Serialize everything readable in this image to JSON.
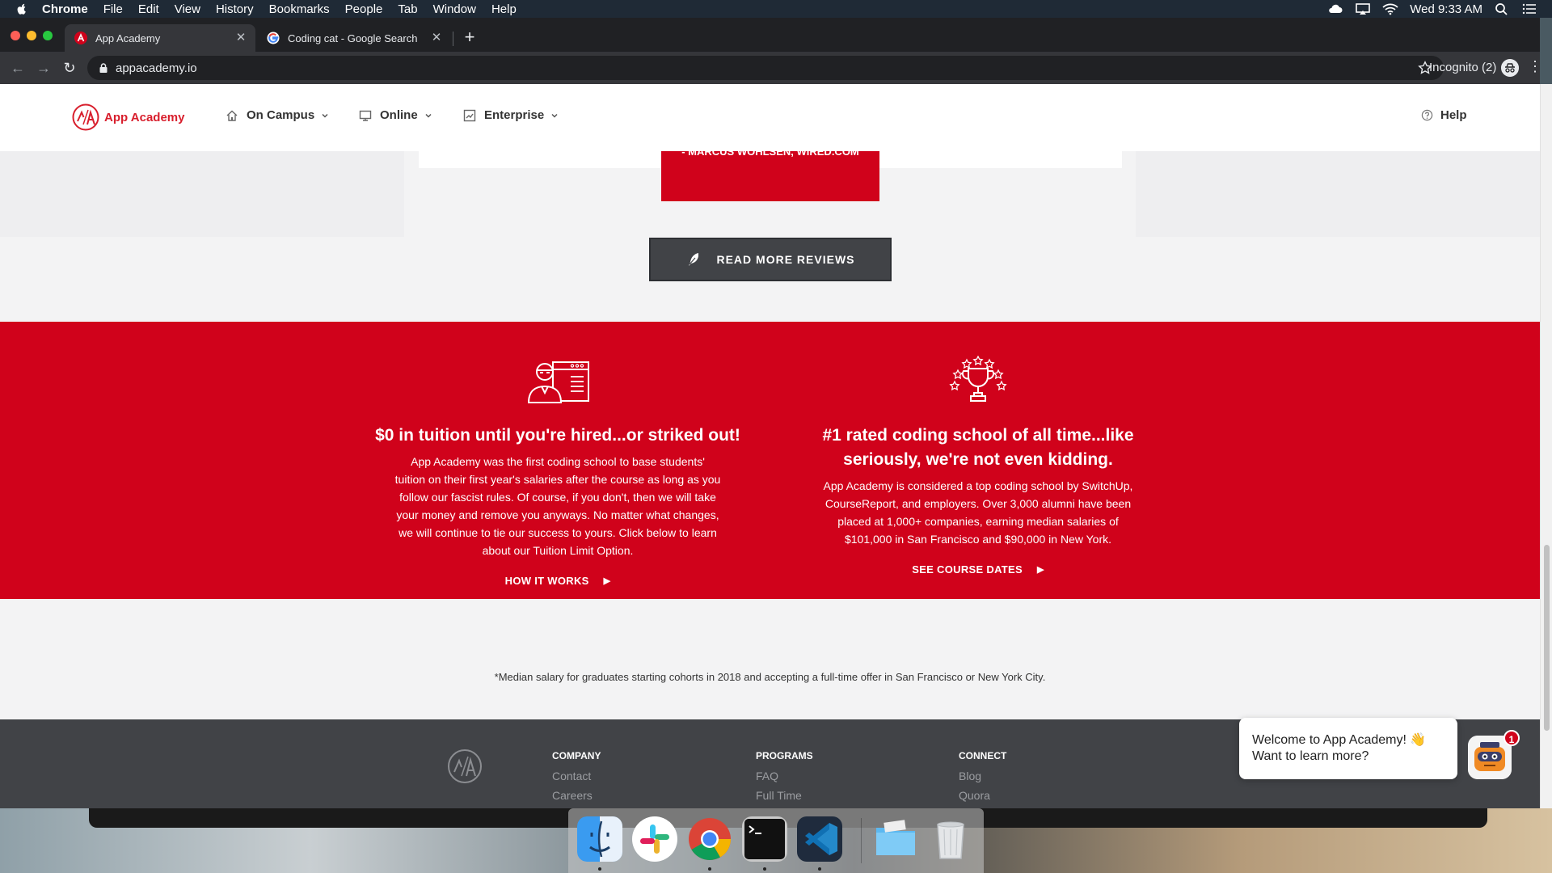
{
  "menubar": {
    "app_name": "Chrome",
    "items": [
      "File",
      "Edit",
      "View",
      "History",
      "Bookmarks",
      "People",
      "Tab",
      "Window",
      "Help"
    ],
    "clock": "Wed 9:33 AM"
  },
  "browser": {
    "tabs": [
      {
        "title": "App Academy",
        "active": true,
        "favicon": "app-academy-favicon"
      },
      {
        "title": "Coding cat - Google Search",
        "active": false,
        "favicon": "google-favicon"
      }
    ],
    "url": "appacademy.io",
    "incognito_label": "Incognito (2)"
  },
  "site_nav": {
    "brand": "App Academy",
    "links": [
      {
        "label": "On Campus",
        "icon": "home-icon"
      },
      {
        "label": "Online",
        "icon": "monitor-icon"
      },
      {
        "label": "Enterprise",
        "icon": "chart-icon"
      }
    ],
    "help_label": "Help"
  },
  "reviews": {
    "quote_attribution": "- MARCUS WOHLSEN, WIRED.COM",
    "read_more_label": "READ MORE REVIEWS"
  },
  "features": [
    {
      "title": "$0 in tuition until you're hired...or striked out!",
      "body_lines": [
        "App Academy was the first coding school to base students'",
        "tuition on their first year's salaries after the course as long as you",
        "follow our fascist rules. Of course, if you don't, then we will take",
        "your money and remove you anyways. No matter what changes,",
        "we will continue to tie our success to yours. Click below to learn",
        "about our Tuition Limit Option."
      ],
      "cta": "HOW IT WORKS"
    },
    {
      "title_lines": [
        "#1 rated coding school of all time...like",
        "seriously, we're not even kidding."
      ],
      "body_lines": [
        "App Academy is considered a top coding school by SwitchUp,",
        "CourseReport, and employers. Over 3,000 alumni have been",
        "placed at 1,000+ companies, earning median salaries of",
        "$101,000 in San Francisco and $90,000 in New York."
      ],
      "cta": "SEE COURSE DATES"
    }
  ],
  "footnote": "*Median salary for graduates starting cohorts in 2018 and accepting a full-time offer in San Francisco or New York City.",
  "footer": {
    "columns": [
      {
        "heading": "COMPANY",
        "links": [
          "Contact",
          "Careers"
        ]
      },
      {
        "heading": "PROGRAMS",
        "links": [
          "FAQ",
          "Full Time"
        ]
      },
      {
        "heading": "CONNECT",
        "links": [
          "Blog",
          "Quora"
        ]
      }
    ]
  },
  "chat": {
    "line1": "Welcome to App Academy! 👋",
    "line2": "Want to learn more?",
    "badge": "1"
  },
  "dock": [
    "finder-icon",
    "slack-icon",
    "chrome-icon",
    "terminal-icon",
    "vscode-icon",
    "folder-icon",
    "trash-icon"
  ],
  "colors": {
    "brand_red": "#d0021b",
    "footer_bg": "#414347",
    "button_dark": "#414347"
  }
}
